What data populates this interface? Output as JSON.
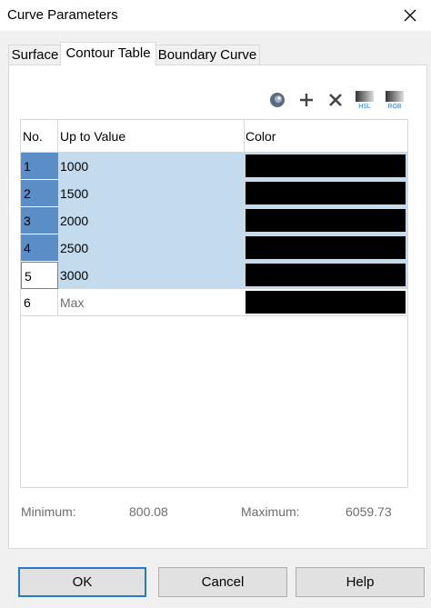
{
  "window": {
    "title": "Curve Parameters"
  },
  "tabs": [
    {
      "label": "Surface",
      "active": false
    },
    {
      "label": "Contour Table",
      "active": true
    },
    {
      "label": "Boundary Curve",
      "active": false
    }
  ],
  "toolbar": {
    "icons": [
      "color-wheel-icon",
      "add-icon",
      "delete-icon",
      "hsl-gradient-icon",
      "rgb-gradient-icon"
    ],
    "hsl_caption": "HSL",
    "rgb_caption": "RGB"
  },
  "table": {
    "columns": [
      "No.",
      "Up to Value",
      "Color"
    ],
    "rows": [
      {
        "no": "1",
        "value": "1000",
        "color": "#000000",
        "state": "selected"
      },
      {
        "no": "2",
        "value": "1500",
        "color": "#000000",
        "state": "selected"
      },
      {
        "no": "3",
        "value": "2000",
        "color": "#000000",
        "state": "selected"
      },
      {
        "no": "4",
        "value": "2500",
        "color": "#000000",
        "state": "selected"
      },
      {
        "no": "5",
        "value": "3000",
        "color": "#000000",
        "state": "current"
      },
      {
        "no": "6",
        "value": "Max",
        "color": "#000000",
        "state": "normal"
      }
    ]
  },
  "stats": {
    "minimum_label": "Minimum:",
    "minimum_value": "800.08",
    "maximum_label": "Maximum:",
    "maximum_value": "6059.73"
  },
  "buttons": {
    "ok": "OK",
    "cancel": "Cancel",
    "help": "Help"
  },
  "colors": {
    "selection_row": "#c4dbee",
    "selection_index": "#5b8ec6",
    "default_button_border": "#2a79c7"
  }
}
